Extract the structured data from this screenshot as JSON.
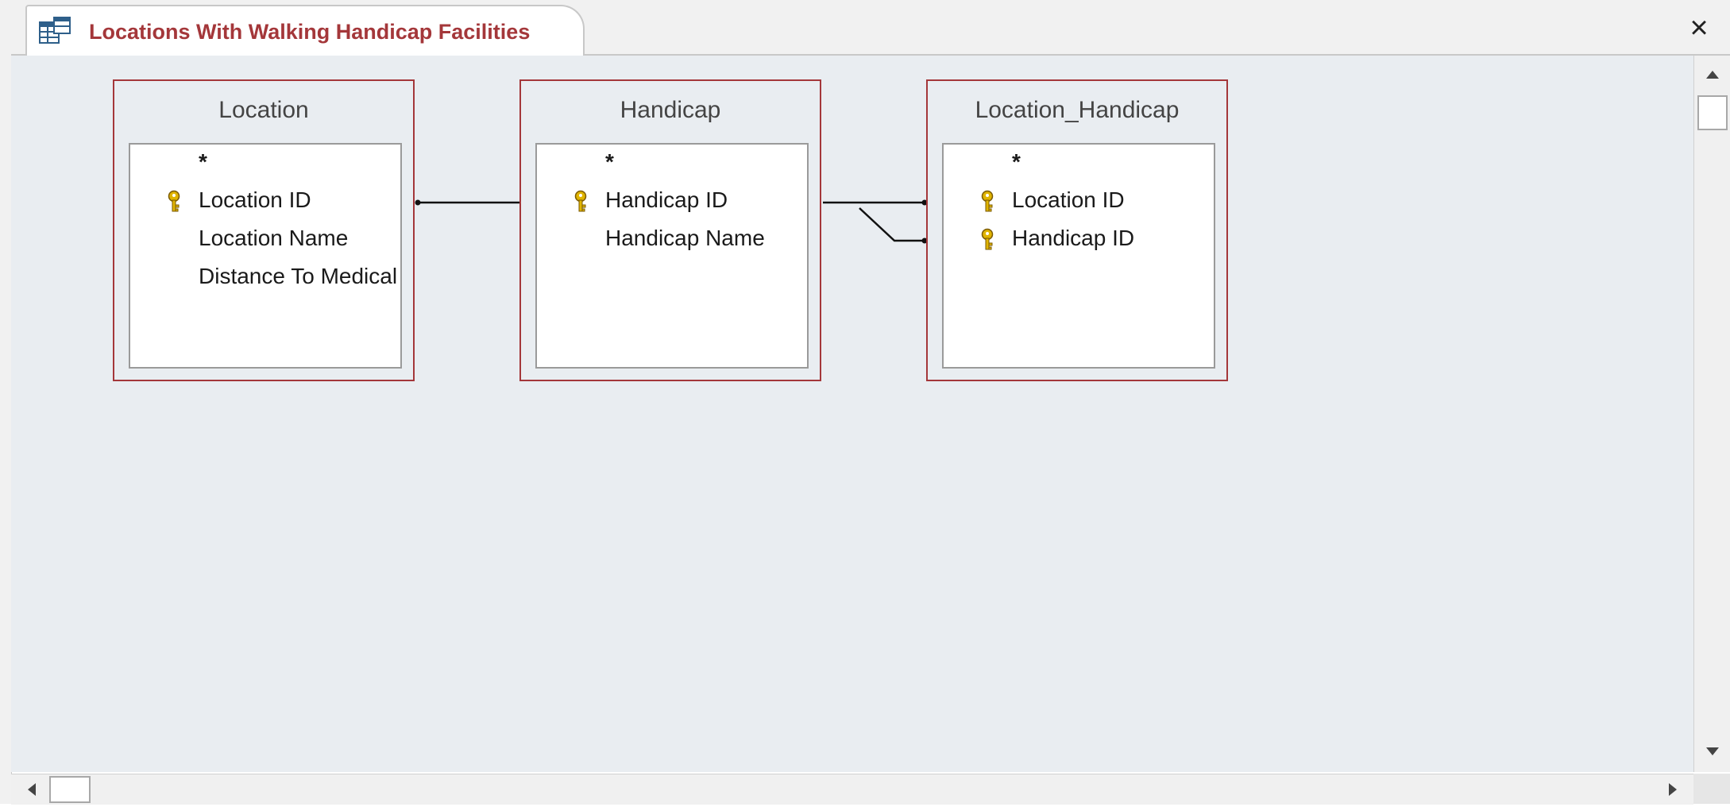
{
  "window": {
    "tab_title": "Locations With Walking Handicap Facilities",
    "tab_icon": "query-design-icon",
    "close_label": "×"
  },
  "tables": [
    {
      "name": "Location",
      "fields": [
        {
          "label": "*",
          "primary_key": false
        },
        {
          "label": "Location ID",
          "primary_key": true
        },
        {
          "label": "Location Name",
          "primary_key": false
        },
        {
          "label": "Distance To Medical",
          "primary_key": false
        }
      ]
    },
    {
      "name": "Handicap",
      "fields": [
        {
          "label": "*",
          "primary_key": false
        },
        {
          "label": "Handicap ID",
          "primary_key": true
        },
        {
          "label": "Handicap Name",
          "primary_key": false
        }
      ]
    },
    {
      "name": "Location_Handicap",
      "fields": [
        {
          "label": "*",
          "primary_key": false
        },
        {
          "label": "Location ID",
          "primary_key": true
        },
        {
          "label": "Handicap ID",
          "primary_key": true
        }
      ]
    }
  ],
  "colors": {
    "accent": "#a4373a",
    "canvas": "#e9edf1",
    "key_icon": "#e0b400"
  }
}
